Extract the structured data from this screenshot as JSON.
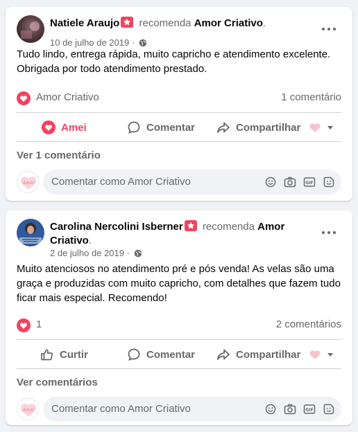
{
  "posts": [
    {
      "author": "Natiele Araujo",
      "recommends": "recomenda",
      "page": "Amor Criativo",
      "period": ".",
      "date": "10 de julho de 2019 ·",
      "text": "Tudo lindo, entrega rápida, muito capricho e atendimento excelente. Obrigada por todo atendimento prestado.",
      "reaction_summary": "Amor Criativo",
      "comments_count": "1 comentário",
      "like_label": "Amei",
      "comment_label": "Comentar",
      "share_label": "Compartilhar",
      "view_comments": "Ver 1 comentário",
      "composer_placeholder": "Comentar como Amor Criativo"
    },
    {
      "author": "Carolina Nercolini Isberner",
      "recommends": "recomenda",
      "page": "Amor Criativo",
      "period": ".",
      "date": "2 de julho de 2019 ·",
      "text": "Muito atenciosos no atendimento pré e pós venda! As velas são uma graça e produzidas com muito capricho, com detalhes que fazem tudo ficar mais especial. Recomendo!",
      "reaction_summary": "1",
      "comments_count": "2 comentários",
      "like_label": "Curtir",
      "comment_label": "Comentar",
      "share_label": "Compartilhar",
      "view_comments": "Ver comentários",
      "composer_placeholder": "Comentar como Amor Criativo"
    }
  ],
  "colors": {
    "accent": "#f3425f",
    "muted": "#65676b",
    "background": "#f0f2f5"
  }
}
